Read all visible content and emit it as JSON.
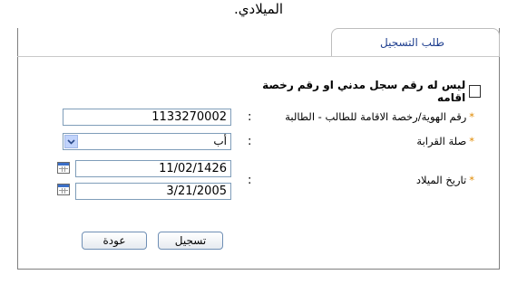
{
  "top_text": "الميلادي.",
  "tab": {
    "label": "طلب التسجيل"
  },
  "form": {
    "no_id_checkbox": {
      "label": "ليس له رقم سجل مدني او رقم رخصة اقامه",
      "checked": false
    },
    "id_field": {
      "label": "رقم الهوية/رخصة الاقامة للطالب - الطالبة",
      "value": "1133270002"
    },
    "relation_field": {
      "label": "صلة القرابة",
      "selected": "أب"
    },
    "birth_date": {
      "label": "تاريخ الميلاد",
      "hijri_value": "11/02/1426",
      "gregorian_value": "3/21/2005"
    },
    "colon": ":",
    "required_mark": "*"
  },
  "buttons": {
    "register": "تسجيل",
    "back": "عودة"
  },
  "colors": {
    "tab_text": "#1f3f8f",
    "required": "#e08a00",
    "input_border": "#7f9db9"
  }
}
